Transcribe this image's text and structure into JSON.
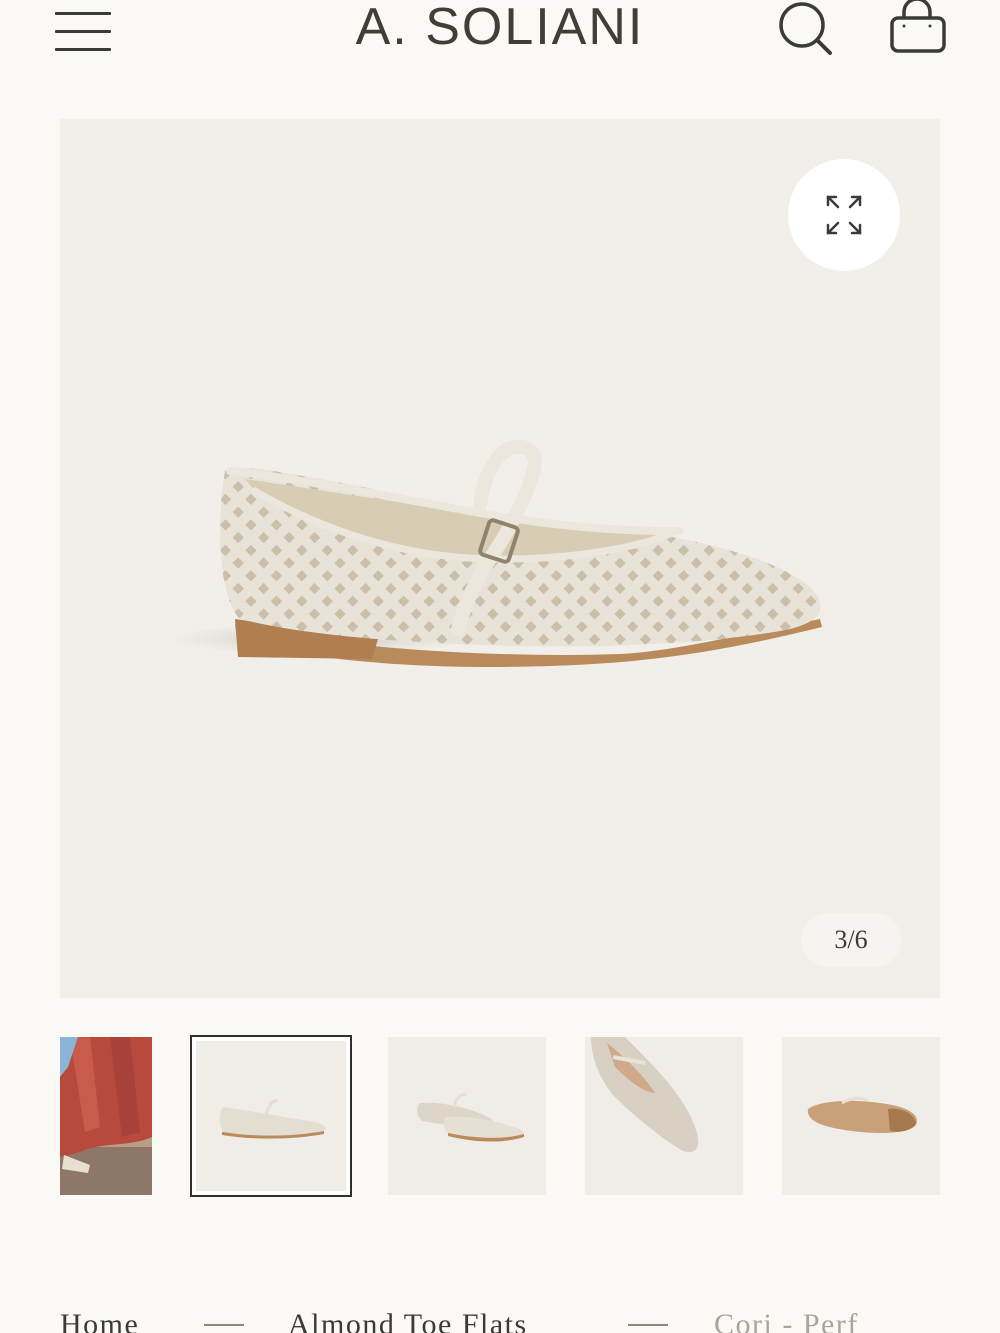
{
  "header": {
    "brand": "A. SOLIANI",
    "menu_icon": "hamburger-menu-icon",
    "search_icon": "search-icon",
    "bag_icon": "shopping-bag-icon"
  },
  "gallery": {
    "counter": "3/6",
    "expand_icon": "expand-arrows-icon",
    "active_index": 1,
    "thumbnails": [
      "lifestyle-red-skirt-thumb",
      "side-view-thumb",
      "pair-view-thumb",
      "top-view-thumb",
      "sole-view-thumb"
    ]
  },
  "breadcrumb": {
    "items": [
      "Home",
      "Almond Toe Flats",
      "Cori - Perf"
    ]
  },
  "colors": {
    "background": "#fbf9f6",
    "image_bg": "#f2efea",
    "shoe": "#e6e0d4",
    "sole": "#b98a5c",
    "text": "#3a3a36",
    "muted": "#a9a49c"
  }
}
